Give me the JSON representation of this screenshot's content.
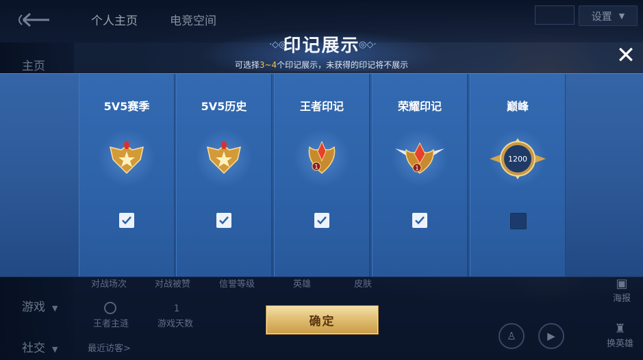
{
  "background": {
    "tabs": [
      "个人主页",
      "电竞空间"
    ],
    "settings_label": "设置",
    "sidebar": {
      "home": "主页",
      "game": "游戏",
      "social": "社交"
    },
    "stats_labels": [
      "对战场次",
      "对战被赞",
      "信誉等级",
      "英雄",
      "皮肤"
    ],
    "profile_value": "王者主涟",
    "days_value": "1",
    "days_label": "游戏天数",
    "recent_visitors": "最近访客>",
    "right_buttons": {
      "poster": "海报",
      "switch_hero": "换英雄"
    }
  },
  "modal": {
    "title": "印记展示",
    "subtitle_prefix": "可选择",
    "subtitle_highlight": "3~4",
    "subtitle_suffix": "个印记展示，未获得的印记将不展示",
    "confirm_label": "确定",
    "accent_color": "#f5c349",
    "cards": [
      {
        "title": "5V5赛季",
        "icon": "season-emblem-icon",
        "checked": true
      },
      {
        "title": "5V5历史",
        "icon": "history-emblem-icon",
        "checked": true
      },
      {
        "title": "王者印记",
        "icon": "king-emblem-icon",
        "badge": "1",
        "checked": true
      },
      {
        "title": "荣耀印记",
        "icon": "glory-emblem-icon",
        "badge": "1",
        "checked": true
      },
      {
        "title": "巅峰",
        "icon": "peak-emblem-icon",
        "value": "1200",
        "checked": false
      }
    ]
  }
}
